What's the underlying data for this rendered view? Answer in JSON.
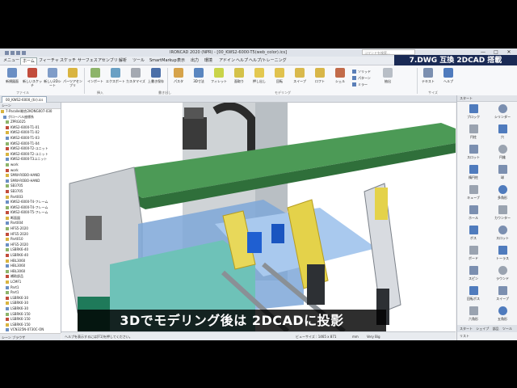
{
  "window": {
    "title": "IRONCAD 2020 (NPR) - [00_KWS2-6000-T5(web_color).ics]",
    "search_placeholder": "コマンドを検索...",
    "minimize": "—",
    "maximize": "□",
    "close": "✕"
  },
  "banner": "7.DWG 互換 2DCAD 搭載",
  "menu": [
    "メニュー",
    "ホーム",
    "フィーチャ",
    "スケッチ",
    "サーフェス",
    "アセンブリ",
    "解析",
    "ツール",
    "SmartMarkup",
    "表示",
    "出力",
    "環境",
    "アドイン",
    "ヘルプ",
    "ヘルプ/トレーニング"
  ],
  "ribbon": {
    "buttons": [
      "新規図面",
      "新しいスケッチ",
      "新しい2Dシート",
      "パーツアセンブリ",
      "インポート",
      "エクスポート",
      "カスタマイズ",
      "上書き保存",
      "パスタ",
      "3D寸法",
      "フィレット",
      "面取り",
      "押し出し",
      "回転",
      "スイープ",
      "ロフト",
      "シェル",
      "抽出",
      "テキスト",
      "ヘルプ"
    ],
    "small_buttons": [
      "ソリッド",
      "パターン",
      "ミラー"
    ],
    "groups": [
      "ファイル",
      "挿入",
      "書き出し",
      "モデリング",
      "サイズ"
    ]
  },
  "document": {
    "tab": "00_KWS2-6000_(tir).ics"
  },
  "tree": {
    "header": "シーン",
    "rows": [
      "7-Parallel総合2KONG007-030",
      "グローバル座標系",
      "ZPRG025",
      "KWS2-6000-T1-01",
      "KWS2-6000-T1-02",
      "KWS2-6000-T1-03",
      "KWS2-6000-T1-04",
      "KWS2-6000-T2-ユニット",
      "KWS2-6000-T2-ユニット",
      "KWS2-6000-T3ユニット",
      "work",
      "work",
      "SMW-ROBO-HAND",
      "SMW-ROBO-HAND",
      "SB3705",
      "SB3705",
      "Part003",
      "KWS2-6000-T4-フレーム",
      "KWS2-6000-T4-フレーム",
      "KWS2-6000-T5-フレーム",
      "断面図",
      "Part004",
      "HFS5-2020",
      "HFS5-2020",
      "Part010",
      "HFS5-2020",
      "LSBRK6-40",
      "LSBRK6-40",
      "HBL3060",
      "HBL3060",
      "HBL3060",
      "補助部品",
      "LCMF1",
      "Part1",
      "Part1",
      "LSBRK6-30",
      "LSBRK6-30",
      "LSBRK6-30",
      "LSBRK6-150",
      "LSBRK6-150",
      "LSBRK6-150",
      "VCN325N-0730C-ON",
      "Assembly002",
      "Assembly003",
      "エアチャック板材",
      "Part021",
      "Part022"
    ],
    "footer": "シーン ブラウザ"
  },
  "status": {
    "left": "ヘルプを表示するには[F1]を押してください。",
    "view": "ビューサイズ : 1465 x 871",
    "mm": "mm",
    "quality": "Very Big"
  },
  "palette": {
    "header": "スタート",
    "items": [
      "ブロック",
      "シリンダー",
      "円柱",
      "穴",
      "スロット",
      "円錐",
      "楕円柱",
      "球",
      "キューブ",
      "多角形",
      "ホール",
      "カウンター",
      "ボス",
      "スロット",
      "ボード",
      "トーラス",
      "スピン",
      "ラウンド",
      "回転ボス",
      "スイープ",
      "六角形",
      "五角形"
    ],
    "tabs": [
      "スタート",
      "シェイプ",
      "部品",
      "ツール"
    ],
    "bottom": "リスト"
  },
  "caption": "3Dでモデリング後は 2DCADに投影",
  "colors": {
    "banner_bg": "#1a2a55",
    "title_bg": "#dfe3ea",
    "ribbon_bg": "#f7f8fa",
    "frame_blue": "#3d6fae",
    "rail_green": "#3f8f4a",
    "guide_yellow": "#e4d24a",
    "teal_base": "#6ec2b8",
    "gray_metal": "#9ea4ab"
  }
}
